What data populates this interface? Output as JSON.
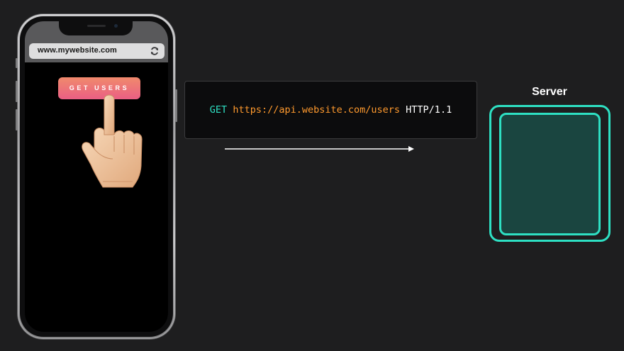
{
  "browser": {
    "url": "www.mywebsite.com",
    "reload_icon": "reload-icon"
  },
  "app": {
    "button_label": "GET USERS",
    "pointer_icon": "pointing-hand-icon"
  },
  "request": {
    "method": "GET",
    "url": "https://api.website.com/users",
    "protocol": "HTTP/1.1"
  },
  "server": {
    "label": "Server"
  },
  "colors": {
    "accent_teal": "#2ee0c3",
    "url_orange": "#ff9a2e",
    "button_gradient_top": "#f08a6c",
    "button_gradient_bottom": "#ea5f84",
    "background": "#1e1e1f"
  }
}
